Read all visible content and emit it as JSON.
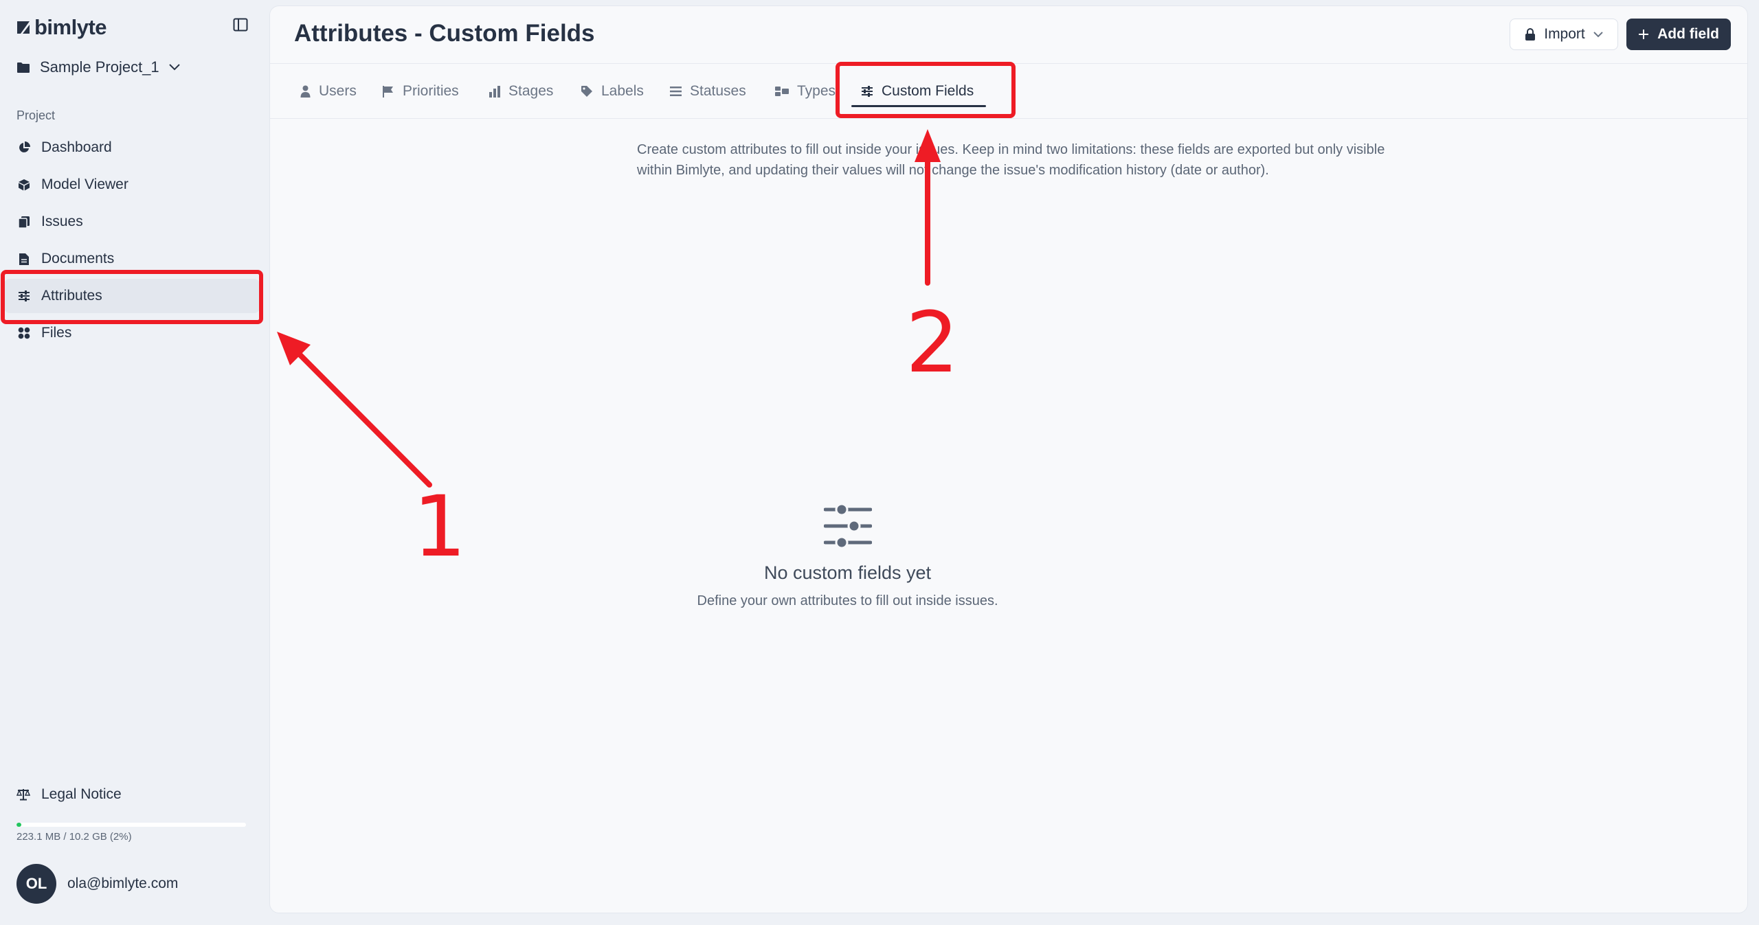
{
  "app": {
    "logo_text": "bimlyte",
    "project_name": "Sample Project_1"
  },
  "sidebar": {
    "section_label": "Project",
    "items": [
      {
        "label": "Dashboard",
        "icon": "pie-chart-icon"
      },
      {
        "label": "Model Viewer",
        "icon": "cube-icon"
      },
      {
        "label": "Issues",
        "icon": "clipboard-icon"
      },
      {
        "label": "Documents",
        "icon": "document-icon"
      },
      {
        "label": "Attributes",
        "icon": "sliders-icon",
        "active": true
      },
      {
        "label": "Files",
        "icon": "grid-icon"
      }
    ],
    "legal_label": "Legal Notice",
    "storage": {
      "text": "223.1 MB / 10.2 GB (2%)",
      "used_fraction": 0.02
    },
    "user": {
      "initials": "OL",
      "email": "ola@bimlyte.com"
    }
  },
  "header": {
    "title": "Attributes - Custom Fields",
    "import_label": "Import",
    "add_label": "Add field"
  },
  "tabs": [
    {
      "label": "Users",
      "icon": "user-icon"
    },
    {
      "label": "Priorities",
      "icon": "flag-icon"
    },
    {
      "label": "Stages",
      "icon": "bar-chart-icon"
    },
    {
      "label": "Labels",
      "icon": "tag-icon"
    },
    {
      "label": "Statuses",
      "icon": "list-icon"
    },
    {
      "label": "Types",
      "icon": "types-icon"
    },
    {
      "label": "Custom Fields",
      "icon": "sliders-icon",
      "active": true
    }
  ],
  "content": {
    "intro": "Create custom attributes to fill out inside your issues. Keep in mind two limitations: these fields are exported but only visible within Bimlyte, and updating their values will not change the issue's modification history (date or author).",
    "empty_title": "No custom fields yet",
    "empty_text": "Define your own attributes to fill out inside issues."
  },
  "annotations": {
    "color": "#ee1c25",
    "step1": "1",
    "step2": "2"
  }
}
